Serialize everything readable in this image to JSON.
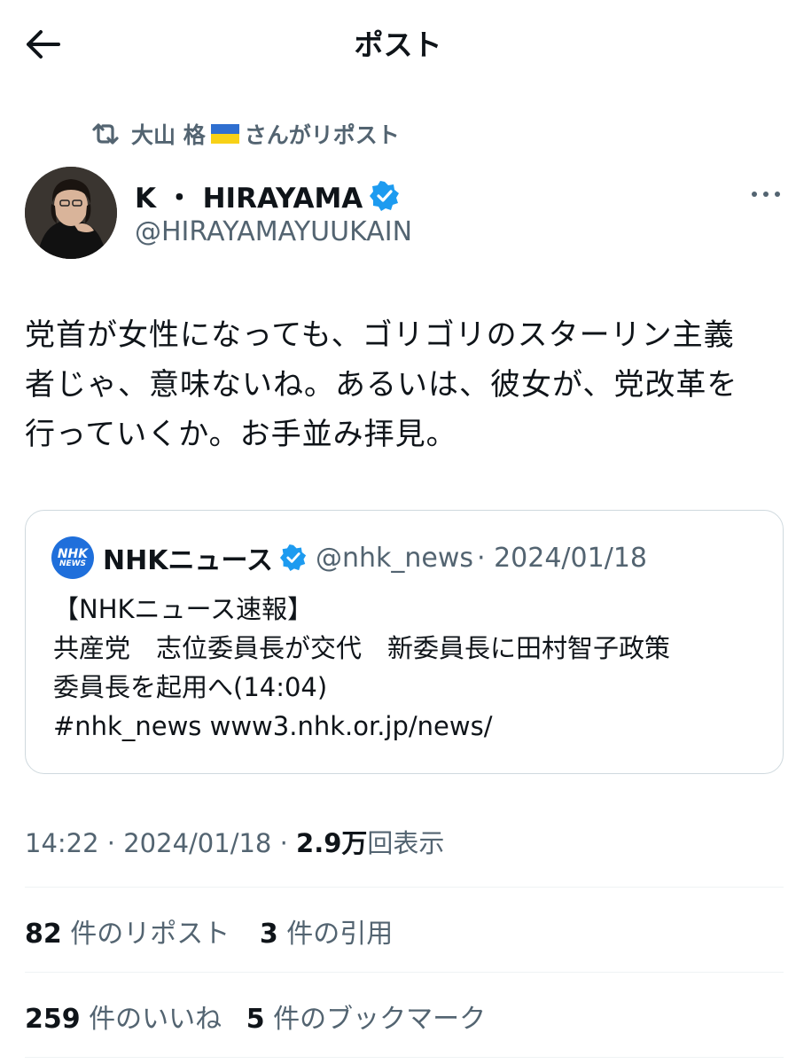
{
  "header": {
    "title": "ポスト",
    "back_icon": "arrow-left-icon"
  },
  "repost": {
    "user": "大山 格",
    "flag": "ukraine-flag-icon",
    "suffix": "さんがリポスト"
  },
  "author": {
    "name": "K ・ HIRAYAMA",
    "handle": "@HIRAYAMAYUUKAIN",
    "verified_color": "#1d9bf0"
  },
  "post": {
    "lines": [
      "党首が女性になっても、ゴリゴリのスターリン主義",
      "者じゃ、意味ないね。あるいは、彼女が、党改革を",
      "行っていくか。お手並み拝見。"
    ]
  },
  "quote": {
    "name": "NHKニュース",
    "handle": "@nhk_news",
    "date": "· 2024/01/18",
    "logo_top": "NHK",
    "logo_bottom": "NEWS",
    "lines": [
      "【NHKニュース速報】",
      "共産党　志位委員長が交代　新委員長に田村智子政策",
      "委員長を起用へ(14:04)",
      "#nhk_news www3.nhk.or.jp/news/"
    ]
  },
  "meta": {
    "time": "14:22",
    "date": "2024/01/18",
    "views": "2.9万",
    "views_label": "回表示",
    "sep": "·"
  },
  "stats": {
    "reposts": "82",
    "reposts_label": "件のリポスト",
    "quotes": "3",
    "quotes_label": "件の引用",
    "likes": "259",
    "likes_label": "件のいいね",
    "bookmarks": "5",
    "bookmarks_label": "件のブックマーク"
  },
  "colors": {
    "text": "#0f1419",
    "secondary": "#536471",
    "accent": "#1d9bf0",
    "nhk_blue": "#1f6fdb"
  }
}
